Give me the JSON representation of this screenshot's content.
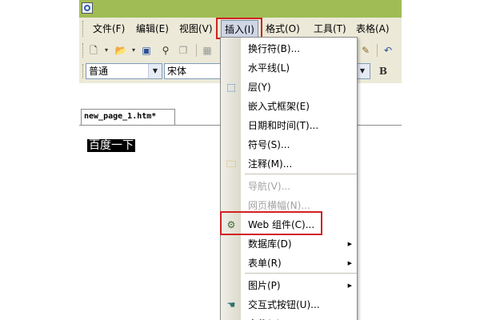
{
  "menubar": {
    "items": [
      "文件(F)",
      "编辑(E)",
      "视图(V)",
      "插入(I)",
      "格式(O)",
      "工具(T)",
      "表格(A)"
    ],
    "active": "插入(I)"
  },
  "toolbar": {
    "style_value": "普通",
    "font_value": "宋体",
    "bold_label": "B"
  },
  "document": {
    "tab_label": "new_page_1.htm*",
    "selected_text": "百度一下"
  },
  "insert_menu": {
    "items": [
      {
        "label": "换行符(B)...",
        "icon": "",
        "enabled": true,
        "submenu": false
      },
      {
        "label": "水平线(L)",
        "icon": "",
        "enabled": true,
        "submenu": false
      },
      {
        "label": "层(Y)",
        "icon": "layer-icon",
        "enabled": true,
        "submenu": false
      },
      {
        "label": "嵌入式框架(E)",
        "icon": "",
        "enabled": true,
        "submenu": false
      },
      {
        "label": "日期和时间(T)...",
        "icon": "",
        "enabled": true,
        "submenu": false
      },
      {
        "label": "符号(S)...",
        "icon": "",
        "enabled": true,
        "submenu": false
      },
      {
        "label": "注释(M)...",
        "icon": "comment-folder-icon",
        "enabled": true,
        "submenu": false
      },
      {
        "label": "导航(V)...",
        "icon": "",
        "enabled": false,
        "submenu": false
      },
      {
        "label": "网页横幅(N)...",
        "icon": "",
        "enabled": false,
        "submenu": false
      },
      {
        "label": "Web 组件(C)...",
        "icon": "web-component-icon",
        "enabled": true,
        "submenu": false
      },
      {
        "label": "数据库(D)",
        "icon": "",
        "enabled": true,
        "submenu": true
      },
      {
        "label": "表单(R)",
        "icon": "",
        "enabled": true,
        "submenu": true
      },
      {
        "label": "图片(P)",
        "icon": "",
        "enabled": true,
        "submenu": true
      },
      {
        "label": "交互式按钮(U)...",
        "icon": "interactive-button-icon",
        "enabled": true,
        "submenu": false
      },
      {
        "label": "文件(F)...",
        "icon": "",
        "enabled": true,
        "submenu": false
      }
    ]
  },
  "colors": {
    "titlebar": "#9fbd54",
    "highlight_box": "#d22222",
    "disabled_text": "#a3a3a3"
  }
}
